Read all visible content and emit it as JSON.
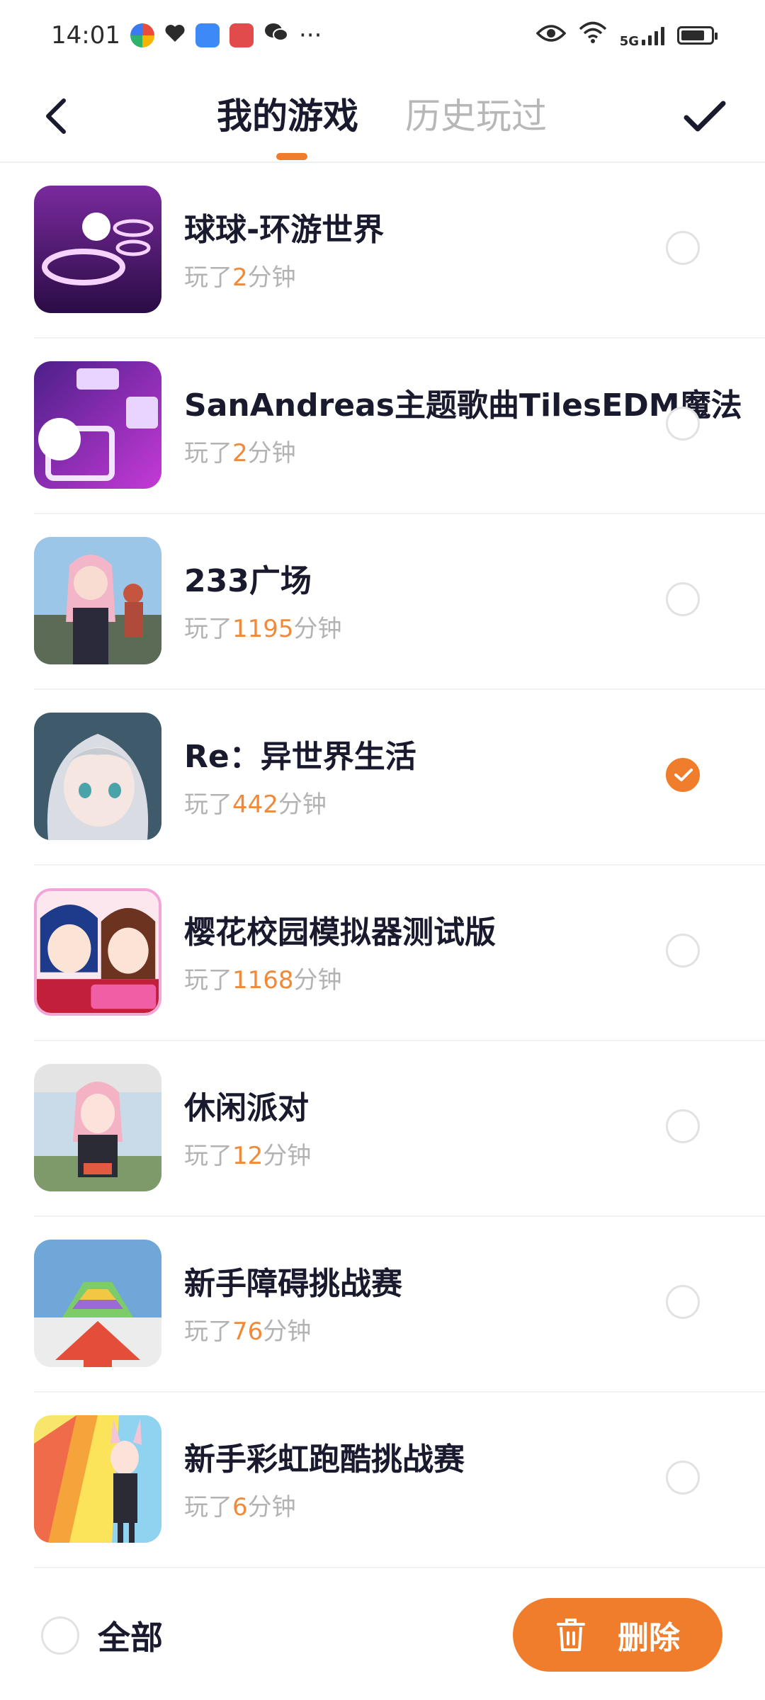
{
  "status_bar": {
    "time": "14:01",
    "more": "···",
    "network": "5G",
    "battery_level": 0.8
  },
  "header": {
    "back_icon": "chevron-left-icon",
    "tabs": [
      {
        "label": "我的游戏",
        "active": true
      },
      {
        "label": "历史玩过",
        "active": false
      }
    ],
    "confirm_icon": "check-icon",
    "accent_color": "#f07d2c"
  },
  "games": [
    {
      "title": "球球-环游世界",
      "played_prefix": "玩了",
      "minutes": "2",
      "played_suffix": "分钟",
      "checked": false
    },
    {
      "title": "SanAndreas主题歌曲TilesEDM魔法",
      "played_prefix": "玩了",
      "minutes": "2",
      "played_suffix": "分钟",
      "checked": false
    },
    {
      "title": "233广场",
      "played_prefix": "玩了",
      "minutes": "1195",
      "played_suffix": "分钟",
      "checked": false
    },
    {
      "title": "Re：异世界生活",
      "played_prefix": "玩了",
      "minutes": "442",
      "played_suffix": "分钟",
      "checked": true
    },
    {
      "title": "樱花校园模拟器测试版",
      "played_prefix": "玩了",
      "minutes": "1168",
      "played_suffix": "分钟",
      "checked": false
    },
    {
      "title": "休闲派对",
      "played_prefix": "玩了",
      "minutes": "12",
      "played_suffix": "分钟",
      "checked": false
    },
    {
      "title": "新手障碍挑战赛",
      "played_prefix": "玩了",
      "minutes": "76",
      "played_suffix": "分钟",
      "checked": false
    },
    {
      "title": "新手彩虹跑酷挑战赛",
      "played_prefix": "玩了",
      "minutes": "6",
      "played_suffix": "分钟",
      "checked": false
    }
  ],
  "footer": {
    "select_all_label": "全部",
    "delete_label": "删除",
    "delete_icon": "trash-icon"
  }
}
